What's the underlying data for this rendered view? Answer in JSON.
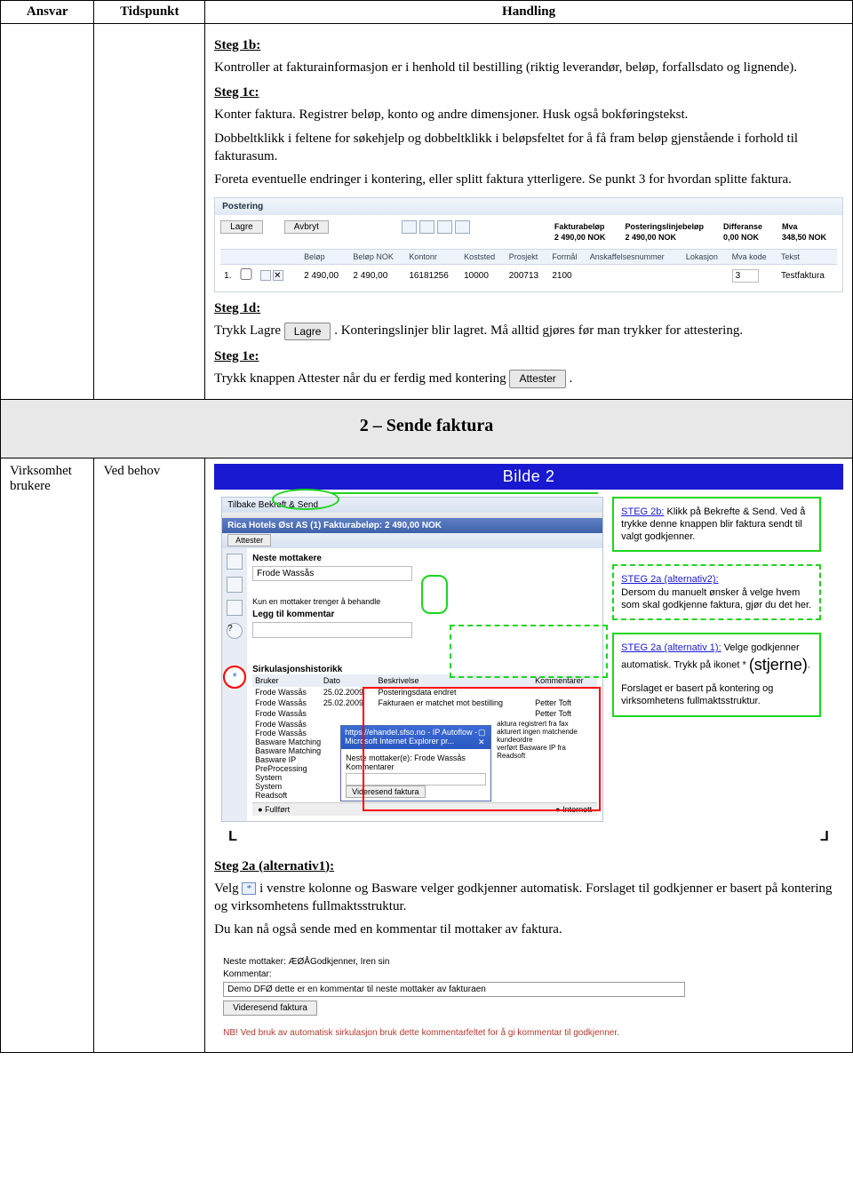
{
  "table": {
    "h1": "Ansvar",
    "h2": "Tidspunkt",
    "h3": "Handling"
  },
  "s1b": {
    "title": "Steg 1b:",
    "p1": "Kontroller at fakturainformasjon er i henhold til bestilling (riktig leverandør, beløp, forfallsdato og lignende)."
  },
  "s1c": {
    "title": "Steg 1c:",
    "p1": "Konter faktura. Registrer beløp, konto og andre dimensjoner. Husk også bokføringstekst.",
    "p2": "Dobbeltklikk i feltene for søkehjelp og dobbeltklikk i beløpsfeltet for å få fram beløp gjenstående i forhold til fakturasum.",
    "p3": "Foreta eventuelle endringer i kontering, eller splitt faktura ytterligere. Se punkt 3 for hvordan splitte faktura."
  },
  "figA": {
    "title": "Postering",
    "lagre": "Lagre",
    "avbryt": "Avbryt",
    "sum": {
      "c1": "Fakturabeløp",
      "c2": "Posteringslinjebeløp",
      "c3": "Differanse",
      "c4": "Mva",
      "v1": "2 490,00 NOK",
      "v2": "2 490,00 NOK",
      "v3": "0,00 NOK",
      "v4": "348,50 NOK"
    },
    "cols": [
      "",
      "",
      "",
      "Beløp",
      "Beløp NOK",
      "Kontonr",
      "Koststed",
      "Prosjekt",
      "Formål",
      "Anskaffelsesnummer",
      "Lokasjon",
      "Mva kode",
      "Tekst"
    ],
    "row": {
      "num": "1.",
      "belop": "2 490,00",
      "beloknok": "2 490,00",
      "konto": "16181256",
      "kost": "10000",
      "prosj": "200713",
      "formal": "2100",
      "mva": "3",
      "tekst": "Testfaktura"
    }
  },
  "s1d": {
    "title": "Steg 1d:",
    "pre": "Trykk Lagre ",
    "btn": "Lagre",
    "post": ". Konteringslinjer blir lagret. Må alltid gjøres før man trykker for attestering."
  },
  "s1e": {
    "title": "Steg 1e:",
    "pre": "Trykk knappen Attester når du er ferdig med kontering ",
    "btn": "Attester",
    "post": "."
  },
  "section2": "2 – Sende faktura",
  "row2": {
    "ansvar": "Virksomhet brukere",
    "tid": "Ved behov"
  },
  "bilde2": {
    "title": "Bilde 2",
    "tabs": "Tilbake    Bekreft & Send",
    "blueline": "Rica Hotels Øst AS (1) Fakturabeløp: 2 490,00 NOK",
    "attester": "Attester",
    "neste": "Neste mottakere",
    "frode": "Frode Wassås",
    "kunen": "Kun en mottaker trenger å behandle",
    "leggtil": "Legg til kommentar",
    "hist": "Sirkulasjonshistorikk",
    "th": {
      "br": "Bruker",
      "dt": "Dato",
      "bs": "Beskrivelse",
      "km": "Kommentarer"
    },
    "rows": [
      {
        "u": "Frode Wassås",
        "d": "25.02.2009",
        "b": "Posteringsdata endret",
        "k": ""
      },
      {
        "u": "Frode Wassås",
        "d": "25.02.2009",
        "b": "Fakturaen er matchet mot bestilling",
        "k": "Petter Toft"
      },
      {
        "u": "Frode Wassås",
        "d": "",
        "b": "",
        "k": "Petter Toft"
      }
    ],
    "more": [
      "Frode Wassås",
      "Frode Wassås",
      "Basware Matching",
      "Basware Matching",
      "Basware IP PreProcessing",
      "System",
      "System",
      "Readsoft"
    ],
    "ie": {
      "title": "https://ehandel.sfso.no - IP Autoflow - Microsoft Internet Explorer pr...",
      "neste": "Neste mottaker(e): Frode Wassås",
      "komm": "Kommentarer",
      "btn": "Videresend faktura",
      "note": "aktura registrert fra fax\nakturert ingen matchende kundeordre\nverført Basware IP fra Readsoft"
    },
    "status": {
      "f": "Fullført",
      "i": "Internett"
    },
    "c2b": {
      "lbl": "STEG 2b:",
      "txt": " Klikk på Bekrefte & Send. Ved å trykke denne knappen blir faktura sendt til valgt godkjenner."
    },
    "c2a2": {
      "lbl": "STEG 2a (alternativ2):",
      "txt": "Dersom du manuelt ønsker å velge hvem som skal godkjenne faktura, gjør du det her."
    },
    "c2a1": {
      "lbl": "STEG 2a (alternativ 1):",
      "txt1": " Velge godkjenner automatisk. Trykk på ikonet * ",
      "stjerne": "(stjerne)",
      "txt2": ".",
      "txt3": "Forslaget er basert på kontering og virksomhetens fullmaktsstruktur."
    }
  },
  "s2a": {
    "title": "Steg 2a (alternativ1):",
    "pre": "Velg ",
    "star": "*",
    "post": " i venstre kolonne og Basware velger godkjenner automatisk. Forslaget til godkjenner er basert på kontering og virksomhetens fullmaktsstruktur.",
    "p2": "Du kan nå også sende med en kommentar til mottaker av faktura."
  },
  "figC": {
    "l1": "Neste mottaker: ÆØÅGodkjenner, Iren sin",
    "l2": "Kommentar:",
    "inp": "Demo DFØ dette er en kommentar til neste mottaker av fakturaen",
    "btn": "Videresend faktura",
    "nb": "NB! Ved bruk av automatisk sirkulasjon bruk dette kommentarfeltet for å gi kommentar til godkjenner."
  }
}
